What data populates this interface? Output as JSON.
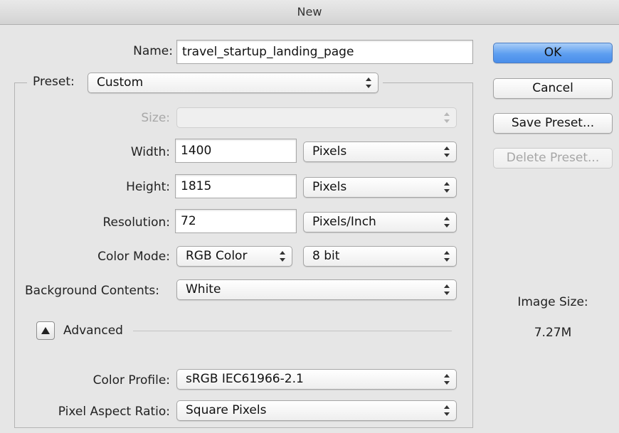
{
  "window": {
    "title": "New"
  },
  "name": {
    "label": "Name:",
    "value": "travel_startup_landing_page"
  },
  "preset": {
    "label": "Preset:",
    "value": "Custom"
  },
  "size": {
    "label": "Size:",
    "value": ""
  },
  "width": {
    "label": "Width:",
    "value": "1400",
    "unit": "Pixels"
  },
  "height": {
    "label": "Height:",
    "value": "1815",
    "unit": "Pixels"
  },
  "resolution": {
    "label": "Resolution:",
    "value": "72",
    "unit": "Pixels/Inch"
  },
  "color_mode": {
    "label": "Color Mode:",
    "mode": "RGB Color",
    "depth": "8 bit"
  },
  "background": {
    "label": "Background Contents:",
    "value": "White"
  },
  "advanced": {
    "label": "Advanced",
    "expanded": true,
    "icon": "triangle-up-icon"
  },
  "color_profile": {
    "label": "Color Profile:",
    "value": "sRGB IEC61966-2.1"
  },
  "pixel_aspect": {
    "label": "Pixel Aspect Ratio:",
    "value": "Square Pixels"
  },
  "buttons": {
    "ok": "OK",
    "cancel": "Cancel",
    "save_preset": "Save Preset...",
    "delete_preset": "Delete Preset..."
  },
  "image_size": {
    "label": "Image Size:",
    "value": "7.27M"
  },
  "colors": {
    "accent": "#5d9ef0",
    "background": "#e6e6e6"
  }
}
